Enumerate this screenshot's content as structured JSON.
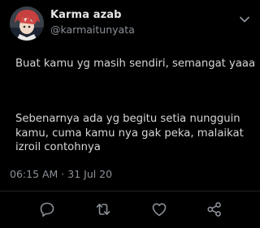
{
  "tweet": {
    "display_name": "Karma azab",
    "handle": "@karmaitunyata",
    "paragraphs": [
      "Buat kamu yg masih sendiri, semangat yaaa",
      "Sebenarnya ada yg begitu setia nungguin kamu, cuma kamu nya gak peka, malaikat izroil contohnya"
    ],
    "timestamp": "06:15 AM · 31 Jul 20"
  },
  "icons": {
    "more": "chevron-down-icon",
    "reply": "reply-icon",
    "retweet": "retweet-icon",
    "like": "heart-icon",
    "share": "share-icon"
  },
  "colors": {
    "background": "#000000",
    "primary_text": "#d6d6d6",
    "secondary_text": "#8b9198",
    "icon": "#8b9198"
  }
}
